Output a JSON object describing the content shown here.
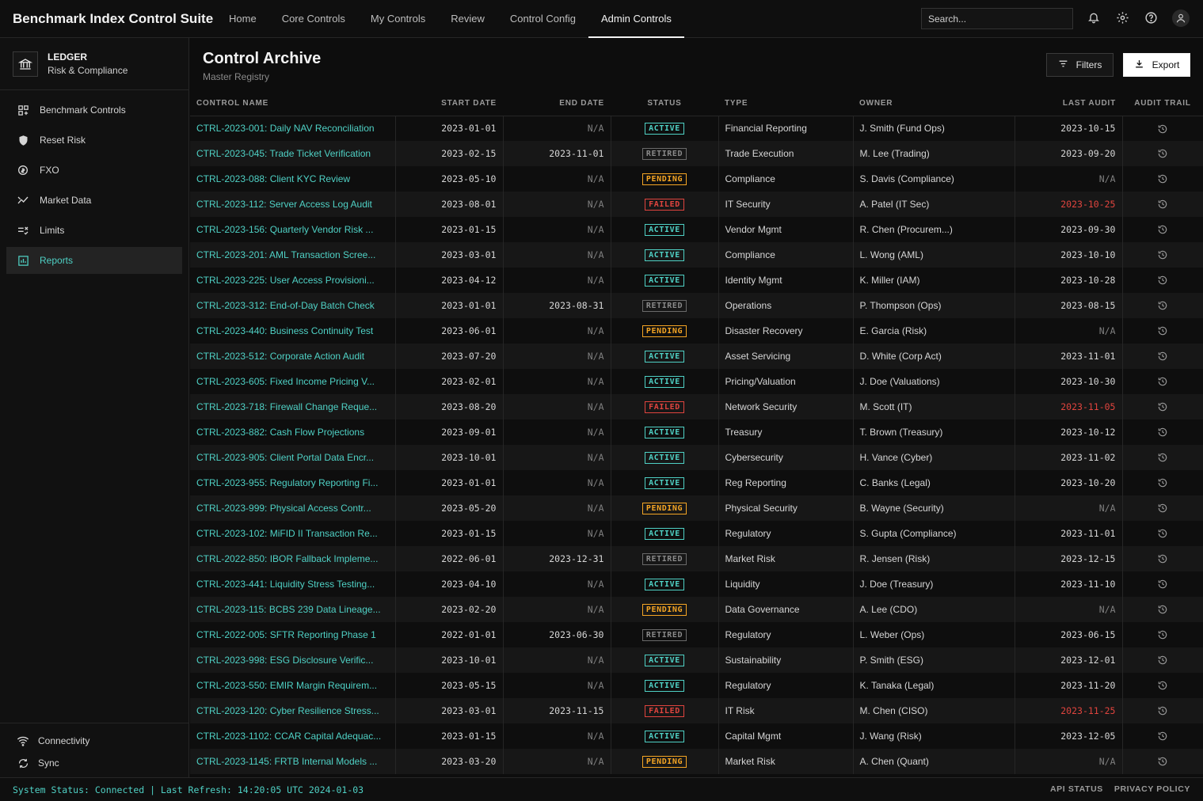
{
  "app": {
    "title": "Benchmark Index Control Suite"
  },
  "nav": [
    {
      "label": "Home",
      "active": false
    },
    {
      "label": "Core Controls",
      "active": false
    },
    {
      "label": "My Controls",
      "active": false
    },
    {
      "label": "Review",
      "active": false
    },
    {
      "label": "Control Config",
      "active": false
    },
    {
      "label": "Admin Controls",
      "active": true
    }
  ],
  "search": {
    "placeholder": "Search..."
  },
  "top_icons": [
    "bell-icon",
    "gear-icon",
    "help-icon",
    "user-icon"
  ],
  "sidebar": {
    "brand": {
      "name": "LEDGER",
      "subtitle": "Risk & Compliance"
    },
    "items": [
      {
        "label": "Benchmark Controls",
        "icon": "grid-plus-icon",
        "active": false
      },
      {
        "label": "Reset Risk",
        "icon": "shield-icon",
        "active": false
      },
      {
        "label": "FXO",
        "icon": "currency-exchange-icon",
        "active": false
      },
      {
        "label": "Market Data",
        "icon": "trend-icon",
        "active": false
      },
      {
        "label": "Limits",
        "icon": "rule-icon",
        "active": false
      },
      {
        "label": "Reports",
        "icon": "bar-chart-icon",
        "active": true
      }
    ],
    "bottom": [
      {
        "label": "Connectivity",
        "icon": "wifi-icon"
      },
      {
        "label": "Sync",
        "icon": "sync-icon"
      }
    ]
  },
  "page": {
    "title": "Control Archive",
    "subtitle": "Master Registry",
    "filters_label": "Filters",
    "export_label": "Export"
  },
  "table": {
    "columns": [
      "CONTROL NAME",
      "START DATE",
      "END DATE",
      "STATUS",
      "TYPE",
      "OWNER",
      "LAST AUDIT",
      "AUDIT TRAIL"
    ],
    "rows": [
      {
        "name": "CTRL-2023-001: Daily NAV Reconciliation",
        "start": "2023-01-01",
        "end": "N/A",
        "status": "ACTIVE",
        "type": "Financial Reporting",
        "owner": "J. Smith (Fund Ops)",
        "audit": "2023-10-15",
        "overdue": false
      },
      {
        "name": "CTRL-2023-045: Trade Ticket Verification",
        "start": "2023-02-15",
        "end": "2023-11-01",
        "status": "RETIRED",
        "type": "Trade Execution",
        "owner": "M. Lee (Trading)",
        "audit": "2023-09-20",
        "overdue": false
      },
      {
        "name": "CTRL-2023-088: Client KYC Review",
        "start": "2023-05-10",
        "end": "N/A",
        "status": "PENDING",
        "type": "Compliance",
        "owner": "S. Davis (Compliance)",
        "audit": "N/A",
        "overdue": false
      },
      {
        "name": "CTRL-2023-112: Server Access Log Audit",
        "start": "2023-08-01",
        "end": "N/A",
        "status": "FAILED",
        "type": "IT Security",
        "owner": "A. Patel (IT Sec)",
        "audit": "2023-10-25",
        "overdue": true
      },
      {
        "name": "CTRL-2023-156: Quarterly Vendor Risk ...",
        "start": "2023-01-15",
        "end": "N/A",
        "status": "ACTIVE",
        "type": "Vendor Mgmt",
        "owner": "R. Chen (Procurem...)",
        "audit": "2023-09-30",
        "overdue": false
      },
      {
        "name": "CTRL-2023-201: AML Transaction Scree...",
        "start": "2023-03-01",
        "end": "N/A",
        "status": "ACTIVE",
        "type": "Compliance",
        "owner": "L. Wong (AML)",
        "audit": "2023-10-10",
        "overdue": false
      },
      {
        "name": "CTRL-2023-225: User Access Provisioni...",
        "start": "2023-04-12",
        "end": "N/A",
        "status": "ACTIVE",
        "type": "Identity Mgmt",
        "owner": "K. Miller (IAM)",
        "audit": "2023-10-28",
        "overdue": false
      },
      {
        "name": "CTRL-2023-312: End-of-Day Batch Check",
        "start": "2023-01-01",
        "end": "2023-08-31",
        "status": "RETIRED",
        "type": "Operations",
        "owner": "P. Thompson (Ops)",
        "audit": "2023-08-15",
        "overdue": false
      },
      {
        "name": "CTRL-2023-440: Business Continuity Test",
        "start": "2023-06-01",
        "end": "N/A",
        "status": "PENDING",
        "type": "Disaster Recovery",
        "owner": "E. Garcia (Risk)",
        "audit": "N/A",
        "overdue": false
      },
      {
        "name": "CTRL-2023-512: Corporate Action Audit",
        "start": "2023-07-20",
        "end": "N/A",
        "status": "ACTIVE",
        "type": "Asset Servicing",
        "owner": "D. White (Corp Act)",
        "audit": "2023-11-01",
        "overdue": false
      },
      {
        "name": "CTRL-2023-605: Fixed Income Pricing V...",
        "start": "2023-02-01",
        "end": "N/A",
        "status": "ACTIVE",
        "type": "Pricing/Valuation",
        "owner": "J. Doe (Valuations)",
        "audit": "2023-10-30",
        "overdue": false
      },
      {
        "name": "CTRL-2023-718: Firewall Change Reque...",
        "start": "2023-08-20",
        "end": "N/A",
        "status": "FAILED",
        "type": "Network Security",
        "owner": "M. Scott (IT)",
        "audit": "2023-11-05",
        "overdue": true
      },
      {
        "name": "CTRL-2023-882: Cash Flow Projections",
        "start": "2023-09-01",
        "end": "N/A",
        "status": "ACTIVE",
        "type": "Treasury",
        "owner": "T. Brown (Treasury)",
        "audit": "2023-10-12",
        "overdue": false
      },
      {
        "name": "CTRL-2023-905: Client Portal Data Encr...",
        "start": "2023-10-01",
        "end": "N/A",
        "status": "ACTIVE",
        "type": "Cybersecurity",
        "owner": "H. Vance (Cyber)",
        "audit": "2023-11-02",
        "overdue": false
      },
      {
        "name": "CTRL-2023-955: Regulatory Reporting Fi...",
        "start": "2023-01-01",
        "end": "N/A",
        "status": "ACTIVE",
        "type": "Reg Reporting",
        "owner": "C. Banks (Legal)",
        "audit": "2023-10-20",
        "overdue": false
      },
      {
        "name": "CTRL-2023-999: Physical Access Contr...",
        "start": "2023-05-20",
        "end": "N/A",
        "status": "PENDING",
        "type": "Physical Security",
        "owner": "B. Wayne (Security)",
        "audit": "N/A",
        "overdue": false
      },
      {
        "name": "CTRL-2023-102: MiFID II Transaction Re...",
        "start": "2023-01-15",
        "end": "N/A",
        "status": "ACTIVE",
        "type": "Regulatory",
        "owner": "S. Gupta (Compliance)",
        "audit": "2023-11-01",
        "overdue": false
      },
      {
        "name": "CTRL-2022-850: IBOR Fallback Impleme...",
        "start": "2022-06-01",
        "end": "2023-12-31",
        "status": "RETIRED",
        "type": "Market Risk",
        "owner": "R. Jensen (Risk)",
        "audit": "2023-12-15",
        "overdue": false
      },
      {
        "name": "CTRL-2023-441: Liquidity Stress Testing...",
        "start": "2023-04-10",
        "end": "N/A",
        "status": "ACTIVE",
        "type": "Liquidity",
        "owner": "J. Doe (Treasury)",
        "audit": "2023-11-10",
        "overdue": false
      },
      {
        "name": "CTRL-2023-115: BCBS 239 Data Lineage...",
        "start": "2023-02-20",
        "end": "N/A",
        "status": "PENDING",
        "type": "Data Governance",
        "owner": "A. Lee (CDO)",
        "audit": "N/A",
        "overdue": false
      },
      {
        "name": "CTRL-2022-005: SFTR Reporting Phase 1",
        "start": "2022-01-01",
        "end": "2023-06-30",
        "status": "RETIRED",
        "type": "Regulatory",
        "owner": "L. Weber (Ops)",
        "audit": "2023-06-15",
        "overdue": false
      },
      {
        "name": "CTRL-2023-998: ESG Disclosure Verific...",
        "start": "2023-10-01",
        "end": "N/A",
        "status": "ACTIVE",
        "type": "Sustainability",
        "owner": "P. Smith (ESG)",
        "audit": "2023-12-01",
        "overdue": false
      },
      {
        "name": "CTRL-2023-550: EMIR Margin Requirem...",
        "start": "2023-05-15",
        "end": "N/A",
        "status": "ACTIVE",
        "type": "Regulatory",
        "owner": "K. Tanaka (Legal)",
        "audit": "2023-11-20",
        "overdue": false
      },
      {
        "name": "CTRL-2023-120: Cyber Resilience Stress...",
        "start": "2023-03-01",
        "end": "2023-11-15",
        "status": "FAILED",
        "type": "IT Risk",
        "owner": "M. Chen (CISO)",
        "audit": "2023-11-25",
        "overdue": true
      },
      {
        "name": "CTRL-2023-1102: CCAR Capital Adequac...",
        "start": "2023-01-15",
        "end": "N/A",
        "status": "ACTIVE",
        "type": "Capital Mgmt",
        "owner": "J. Wang (Risk)",
        "audit": "2023-12-05",
        "overdue": false
      },
      {
        "name": "CTRL-2023-1145: FRTB Internal Models ...",
        "start": "2023-03-20",
        "end": "N/A",
        "status": "PENDING",
        "type": "Market Risk",
        "owner": "A. Chen (Quant)",
        "audit": "N/A",
        "overdue": false
      }
    ]
  },
  "footer": {
    "status": "System Status: Connected | Last Refresh: 14:20:05 UTC 2024-01-03",
    "links": [
      "API STATUS",
      "PRIVACY POLICY"
    ]
  },
  "colors": {
    "accent": "#4fd1c5",
    "active": "#4fd1c5",
    "pending": "#f5a524",
    "failed": "#e0443e",
    "retired": "#8a8a8a"
  }
}
